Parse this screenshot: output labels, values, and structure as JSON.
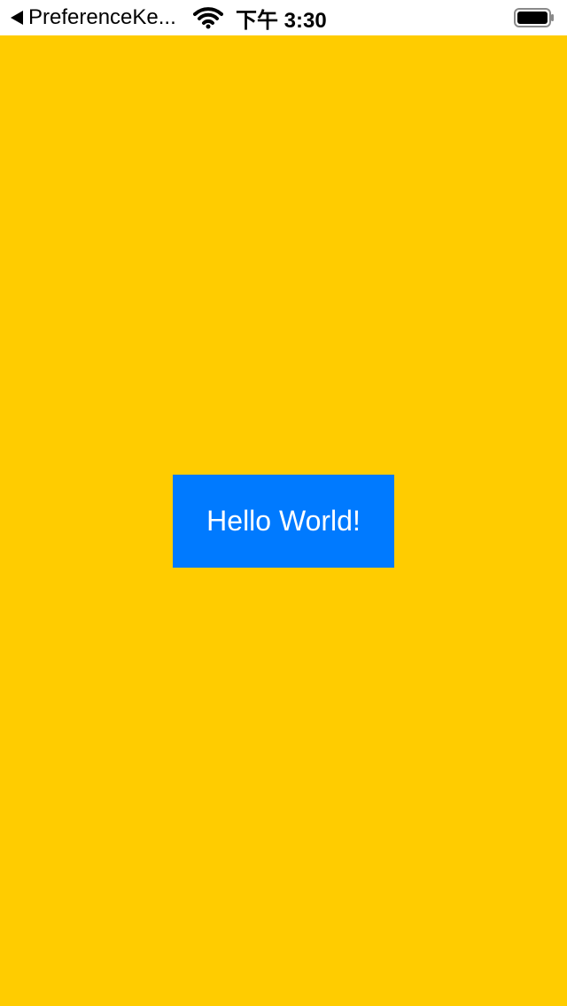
{
  "colors": {
    "background": "#FFCC00",
    "status_bar": "#FFFFFF",
    "button": "#007AFF",
    "button_text": "#FFFFFF"
  },
  "status_bar": {
    "back_icon": "back-arrow-icon",
    "back_label": "PreferenceKe...",
    "wifi_icon": "wifi-icon",
    "time": "下午 3:30",
    "battery_icon": "battery-icon"
  },
  "main": {
    "button_label": "Hello World!"
  }
}
